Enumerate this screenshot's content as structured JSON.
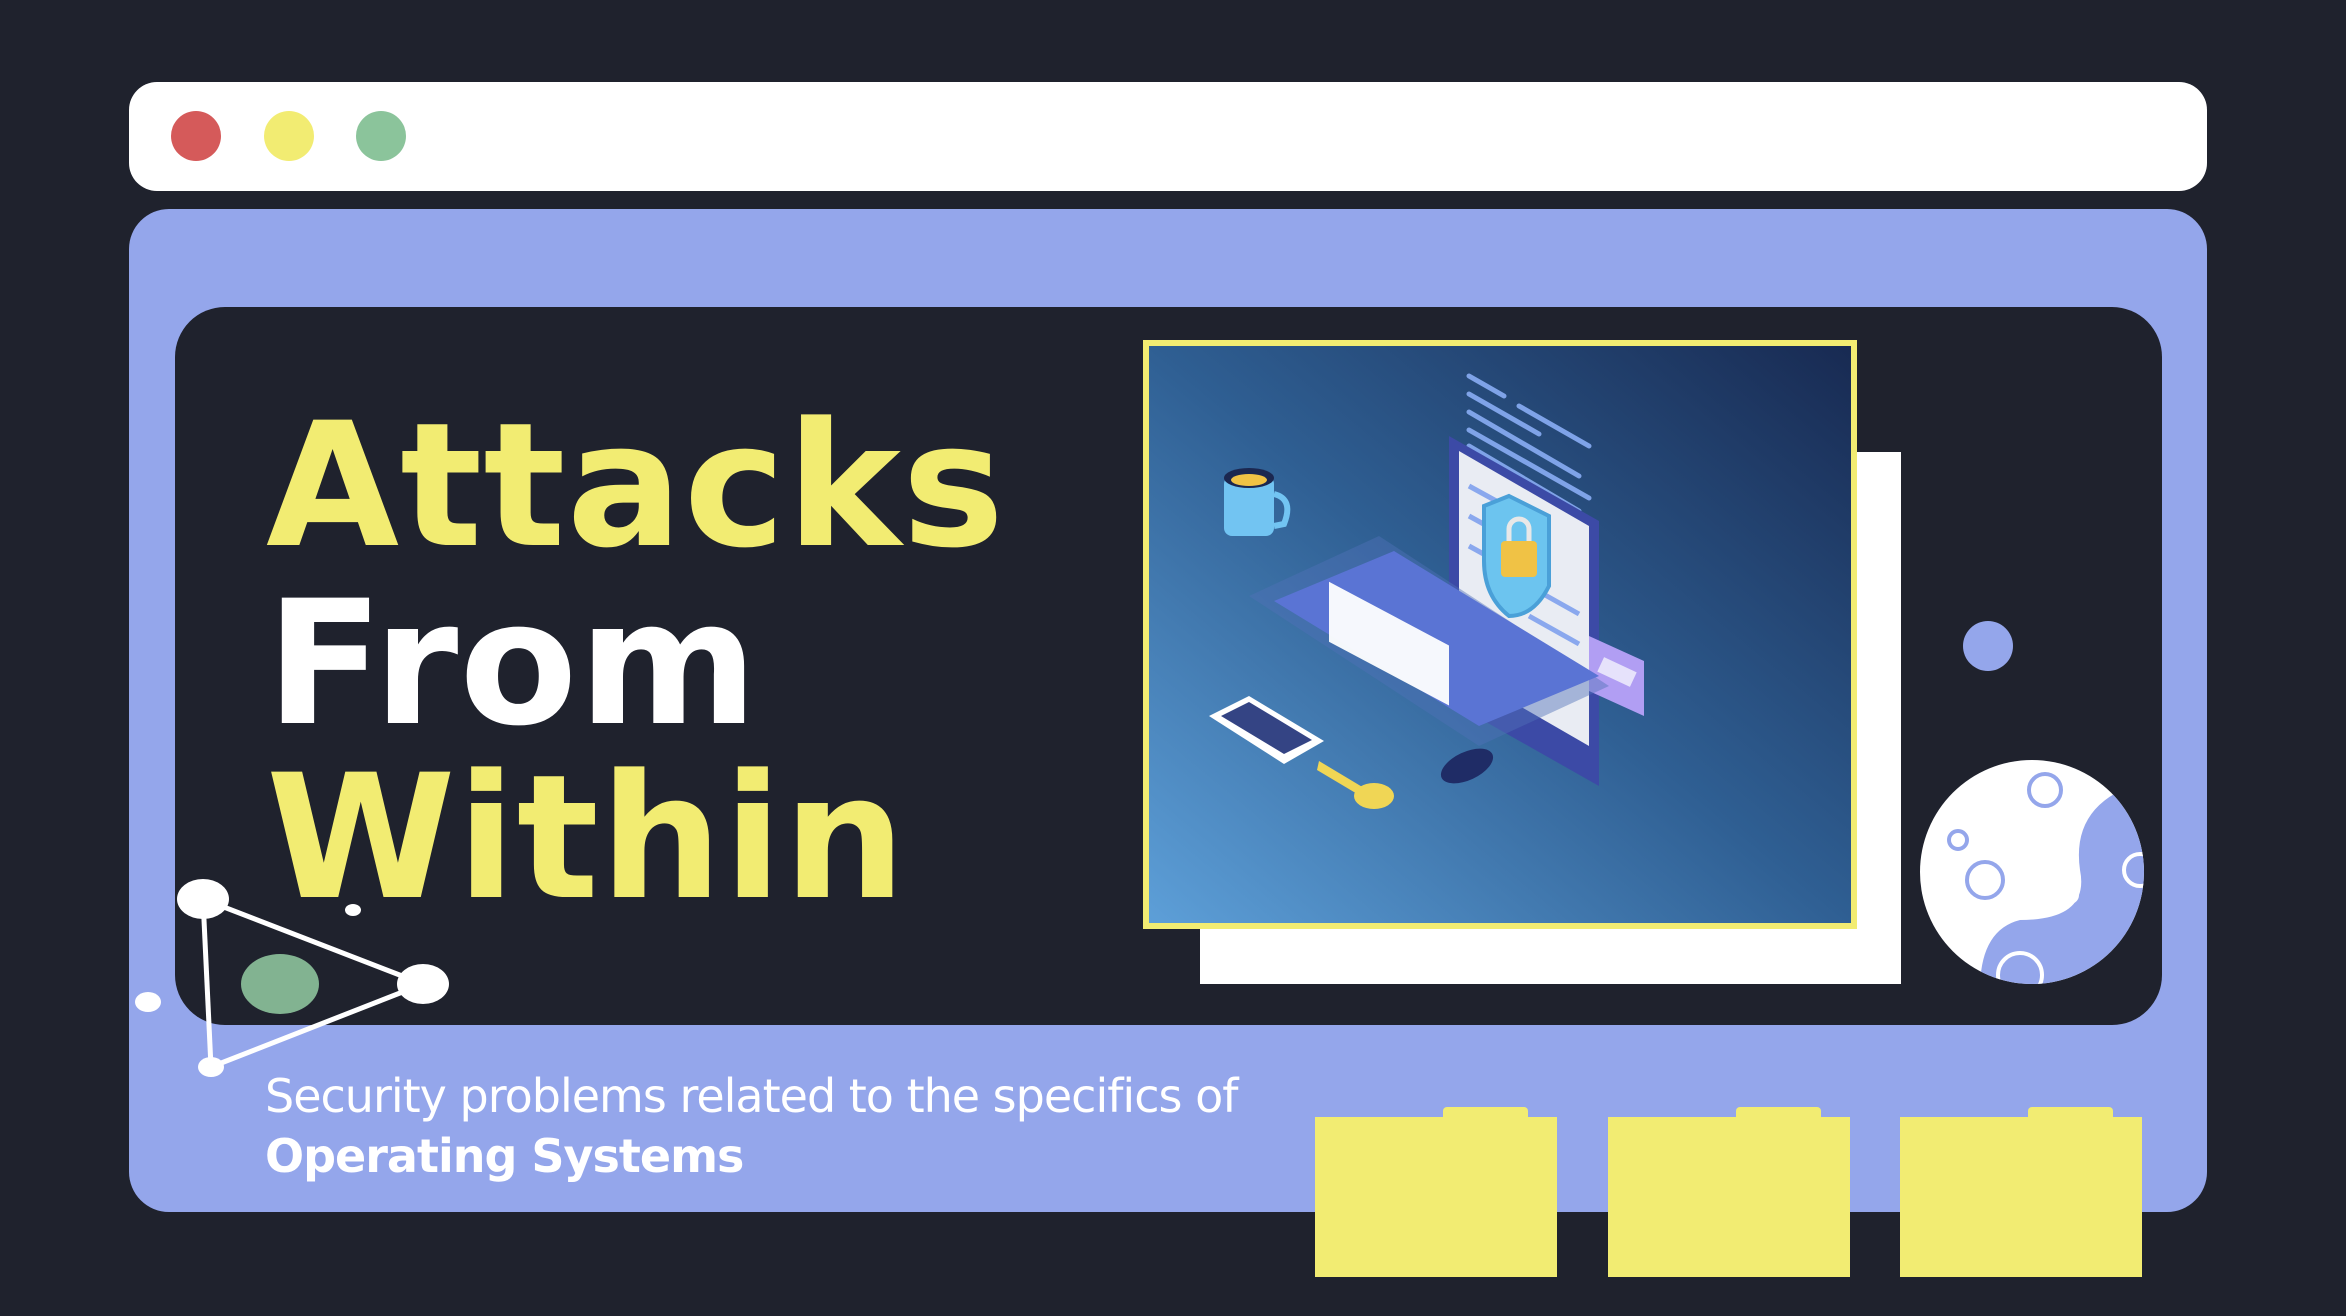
{
  "window": {
    "controls": [
      {
        "name": "close",
        "color": "#d55a5a"
      },
      {
        "name": "minimize",
        "color": "#f2ec72"
      },
      {
        "name": "maximize",
        "color": "#8bc49b"
      }
    ]
  },
  "hero": {
    "title_lines": [
      "Attacks",
      "From",
      "Within"
    ],
    "subtitle_line1": "Security problems related to the specifics of",
    "subtitle_line2": "Operating Systems"
  },
  "illustration": {
    "label": "laptop-security-illustration"
  },
  "colors": {
    "background": "#1f222d",
    "panel": "#94a6eb",
    "accent_yellow": "#f2ec72",
    "white": "#ffffff",
    "green": "#82b391"
  },
  "folders": [
    {
      "name": "folder-1"
    },
    {
      "name": "folder-2"
    },
    {
      "name": "folder-3"
    }
  ]
}
